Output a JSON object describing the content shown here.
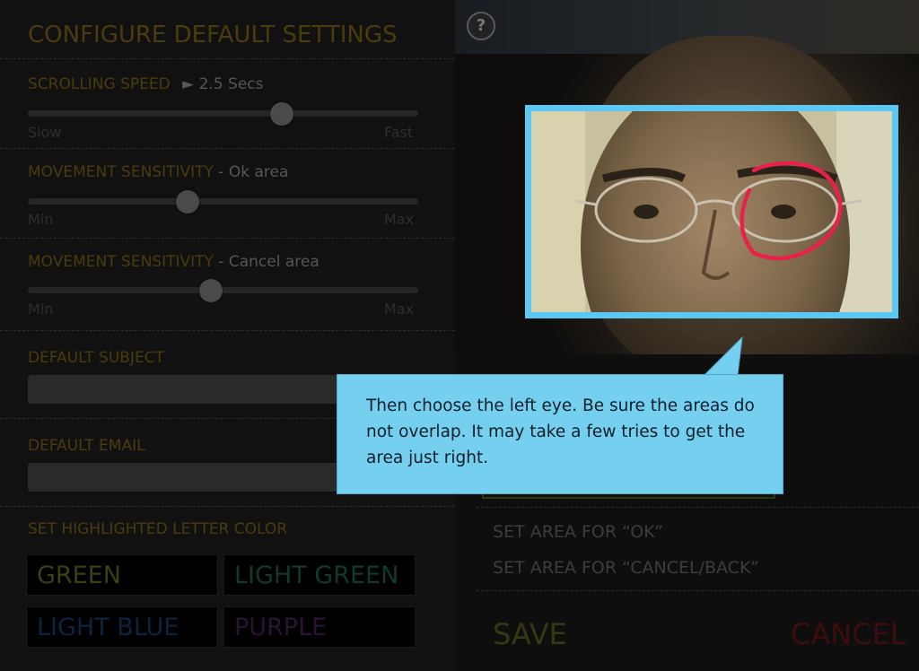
{
  "settings": {
    "title": "CONFIGURE DEFAULT SETTINGS",
    "scrolling_speed": {
      "label": "SCROLLING SPEED",
      "value": "► 2.5 Secs",
      "slow": "Slow",
      "fast": "Fast",
      "level": 0.65
    },
    "ok_sensitivity": {
      "label": "MOVEMENT SENSITIVITY",
      "suffix": " - Ok area",
      "min": "Min",
      "max": "Max",
      "level": 0.41
    },
    "cancel_sensitivity": {
      "label": "MOVEMENT SENSITIVITY",
      "suffix": " - Cancel area",
      "min": "Min",
      "max": "Max",
      "level": 0.47
    },
    "subject_label": "DEFAULT SUBJECT",
    "email_label": "DEFAULT EMAIL",
    "color_label": "SET HIGHLIGHTED LETTER COLOR",
    "colors": [
      {
        "label": "GREEN",
        "color": "#37420f"
      },
      {
        "label": "LIGHT GREEN",
        "color": "#0f3a2c"
      },
      {
        "label": "LIGHT BLUE",
        "color": "#0e233e"
      },
      {
        "label": "PURPLE",
        "color": "#2a1433"
      }
    ]
  },
  "camera": {
    "help": "?",
    "callout": "Then choose the left eye. Be sure the areas do not overlap.  It may take a few tries to get the area just right.",
    "actions": [
      "SET AREA FOR “OK”",
      "SET AREA FOR “CANCEL/BACK”"
    ],
    "save": "SAVE",
    "cancel": "CANCEL",
    "colors": {
      "highlight": "#5bc7f3",
      "callout": "#75cfef",
      "save": "#38380e",
      "cancel": "#3d0d0d",
      "annotation": "#e8214a"
    }
  }
}
